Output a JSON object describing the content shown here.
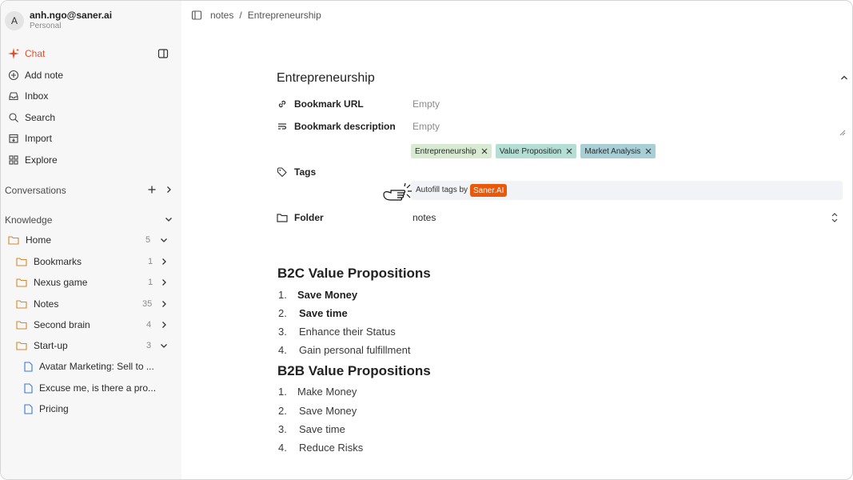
{
  "account": {
    "avatar_letter": "A",
    "email": "anh.ngo@saner.ai",
    "workspace": "Personal"
  },
  "nav": {
    "chat": "Chat",
    "add_note": "Add note",
    "inbox": "Inbox",
    "search": "Search",
    "import": "Import",
    "explore": "Explore"
  },
  "sections": {
    "conversations": "Conversations",
    "knowledge": "Knowledge"
  },
  "tree": {
    "home": {
      "label": "Home",
      "count": "5"
    },
    "folders": [
      {
        "label": "Bookmarks",
        "count": "1"
      },
      {
        "label": "Nexus game",
        "count": "1"
      },
      {
        "label": "Notes",
        "count": "35"
      },
      {
        "label": "Second brain",
        "count": "4"
      },
      {
        "label": "Start-up",
        "count": "3"
      }
    ],
    "docs": [
      {
        "label": "Avatar Marketing: Sell to ..."
      },
      {
        "label": "Excuse me, is there a pro..."
      },
      {
        "label": "Pricing"
      }
    ]
  },
  "breadcrumb": {
    "root": "notes",
    "separator": "/",
    "current": "Entrepreneurship"
  },
  "doc": {
    "title": "Entrepreneurship",
    "props": {
      "bookmark_url_label": "Bookmark URL",
      "bookmark_url_value": "Empty",
      "bookmark_desc_label": "Bookmark description",
      "bookmark_desc_value": "Empty",
      "tags_label": "Tags",
      "folder_label": "Folder",
      "folder_value": "notes"
    },
    "tags": [
      {
        "label": "Entrepreneurship",
        "color": "#d9ead3"
      },
      {
        "label": "Value Proposition",
        "color": "#b4ddd4"
      },
      {
        "label": "Market Analysis",
        "color": "#a9cfd6"
      }
    ],
    "autofill": {
      "text": "Autofill tags by",
      "brand": "Saner.AI"
    }
  },
  "content": {
    "b2c_heading": "B2C Value Propositions",
    "b2c": [
      {
        "num": "1.",
        "text": "Save Money",
        "bold": true
      },
      {
        "num": "2.",
        "text": "Save time",
        "bold": true
      },
      {
        "num": "3.",
        "text": "Enhance their Status",
        "bold": false
      },
      {
        "num": "4.",
        "text": "Gain personal fulfillment",
        "bold": false
      }
    ],
    "b2b_heading": "B2B Value Propositions",
    "b2b": [
      {
        "num": "1.",
        "text": "Make Money"
      },
      {
        "num": "2.",
        "text": "Save Money"
      },
      {
        "num": "3.",
        "text": "Save time"
      },
      {
        "num": "4.",
        "text": "Reduce Risks"
      }
    ]
  }
}
